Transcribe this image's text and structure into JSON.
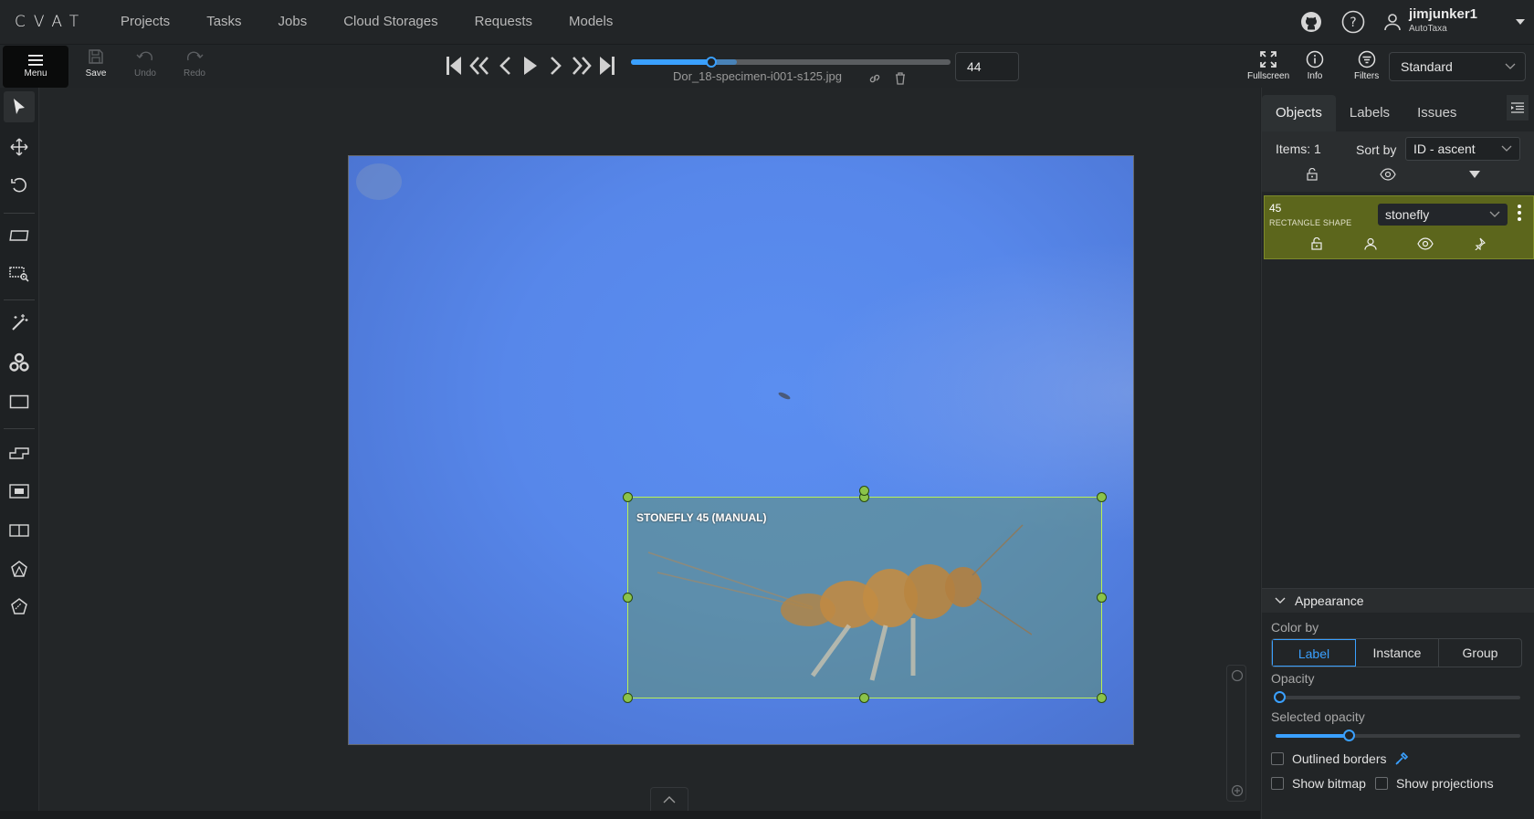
{
  "app": {
    "logo": "CVAT"
  },
  "nav": {
    "links": [
      "Projects",
      "Tasks",
      "Jobs",
      "Cloud Storages",
      "Requests",
      "Models"
    ],
    "user": {
      "name": "jimjunker1",
      "org": "AutoTaxa"
    }
  },
  "toolbar": {
    "menu_label": "Menu",
    "save_label": "Save",
    "undo_label": "Undo",
    "redo_label": "Redo",
    "frame_progress": 0.25,
    "buffer_progress": 0.33,
    "filename": "Dor_18-specimen-i001-s125.jpg",
    "frame_number": "44",
    "fullscreen_label": "Fullscreen",
    "info_label": "Info",
    "filters_label": "Filters",
    "workspace": "Standard"
  },
  "canvas": {
    "box_label": "STONEFLY 45 (MANUAL)"
  },
  "sidebar": {
    "tabs": [
      "Objects",
      "Labels",
      "Issues"
    ],
    "items_count": "Items: 1",
    "sort_by_label": "Sort by",
    "sort_value": "ID - ascent",
    "object": {
      "id": "45",
      "type": "RECTANGLE SHAPE",
      "label": "stonefly",
      "color": "#5c661c"
    },
    "appearance": {
      "title": "Appearance",
      "color_by_label": "Color by",
      "color_by_options": [
        "Label",
        "Instance",
        "Group"
      ],
      "color_by_selected": "Label",
      "opacity_label": "Opacity",
      "opacity_value": 0,
      "selected_opacity_label": "Selected opacity",
      "selected_opacity_value": 0.3,
      "outlined_borders_label": "Outlined borders",
      "show_bitmap_label": "Show bitmap",
      "show_projections_label": "Show projections"
    }
  },
  "colors": {
    "accent": "#3aa0ff",
    "handle": "#8bc34a",
    "box_border": "#b9f05a"
  }
}
